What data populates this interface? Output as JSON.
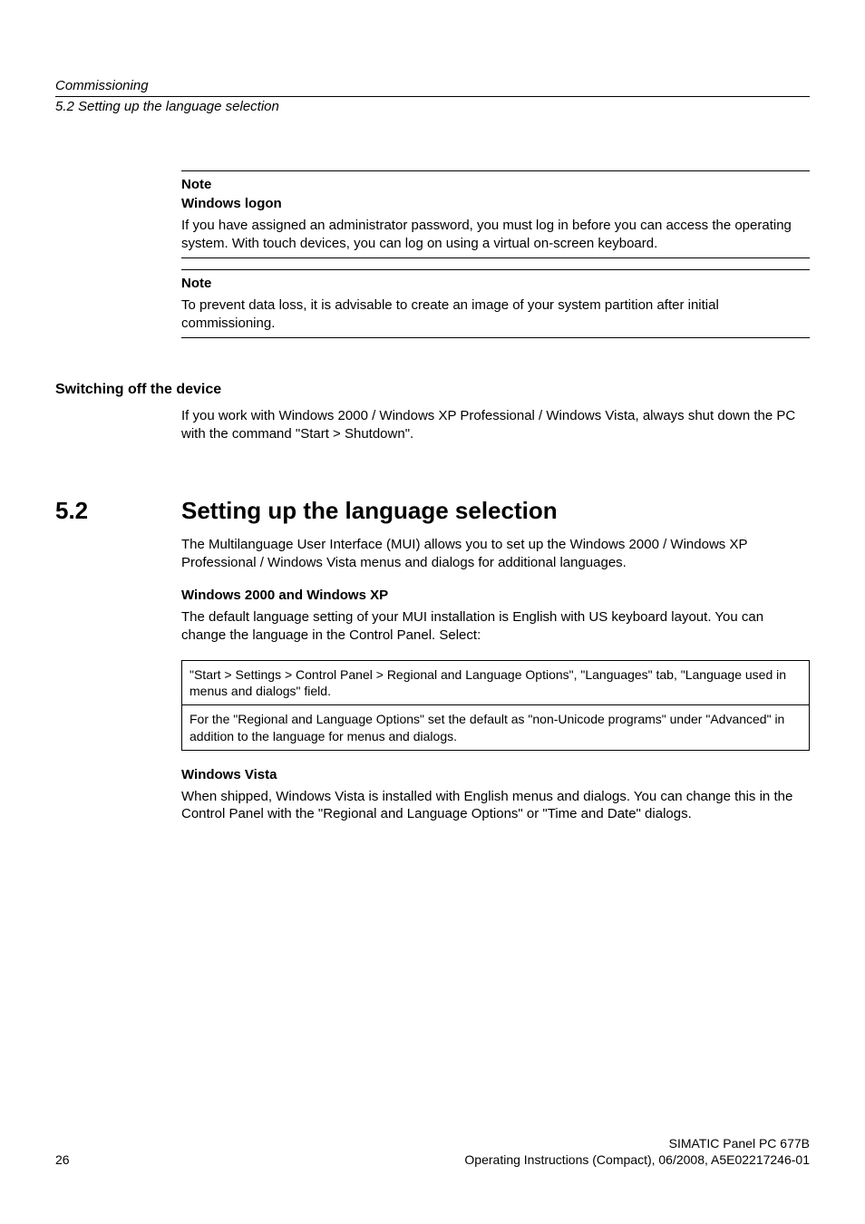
{
  "header": {
    "chapter": "Commissioning",
    "section": "5.2 Setting up the language selection"
  },
  "note1": {
    "title": "Note",
    "sub": "Windows logon",
    "body": "If you have assigned an administrator password, you must log in before you can access the operating system. With touch devices, you can log on using a virtual on-screen keyboard."
  },
  "note2": {
    "title": "Note",
    "body": "To prevent data loss, it is advisable to create an image of your system partition after initial commissioning."
  },
  "switching": {
    "heading": "Switching off the device",
    "body": "If you work with Windows 2000 / Windows XP Professional / Windows Vista, always shut down the PC with the command \"Start > Shutdown\"."
  },
  "section52": {
    "num": "5.2",
    "title": "Setting up the language selection",
    "intro": "The Multilanguage User Interface (MUI) allows you to set up the Windows 2000 / Windows XP Professional / Windows Vista menus and dialogs for additional languages.",
    "w2000xp": {
      "heading": "Windows 2000 and Windows XP",
      "body": "The default language setting of your MUI installation is English with US keyboard layout. You can change the language in the Control Panel. Select:",
      "box1": "\"Start > Settings > Control Panel > Regional and Language Options\", \"Languages\" tab, \"Language used in menus and dialogs\" field.",
      "box2": "For the \"Regional and Language Options\" set the default as \"non-Unicode programs\" under \"Advanced\" in addition to the language for menus and dialogs."
    },
    "vista": {
      "heading": "Windows Vista",
      "body": "When shipped, Windows Vista is installed with English menus and dialogs. You can change this in the Control Panel with the \"Regional and Language Options\" or \"Time and Date\" dialogs."
    }
  },
  "footer": {
    "page": "26",
    "title": "SIMATIC Panel PC 677B",
    "info": "Operating Instructions (Compact), 06/2008, A5E02217246-01"
  }
}
